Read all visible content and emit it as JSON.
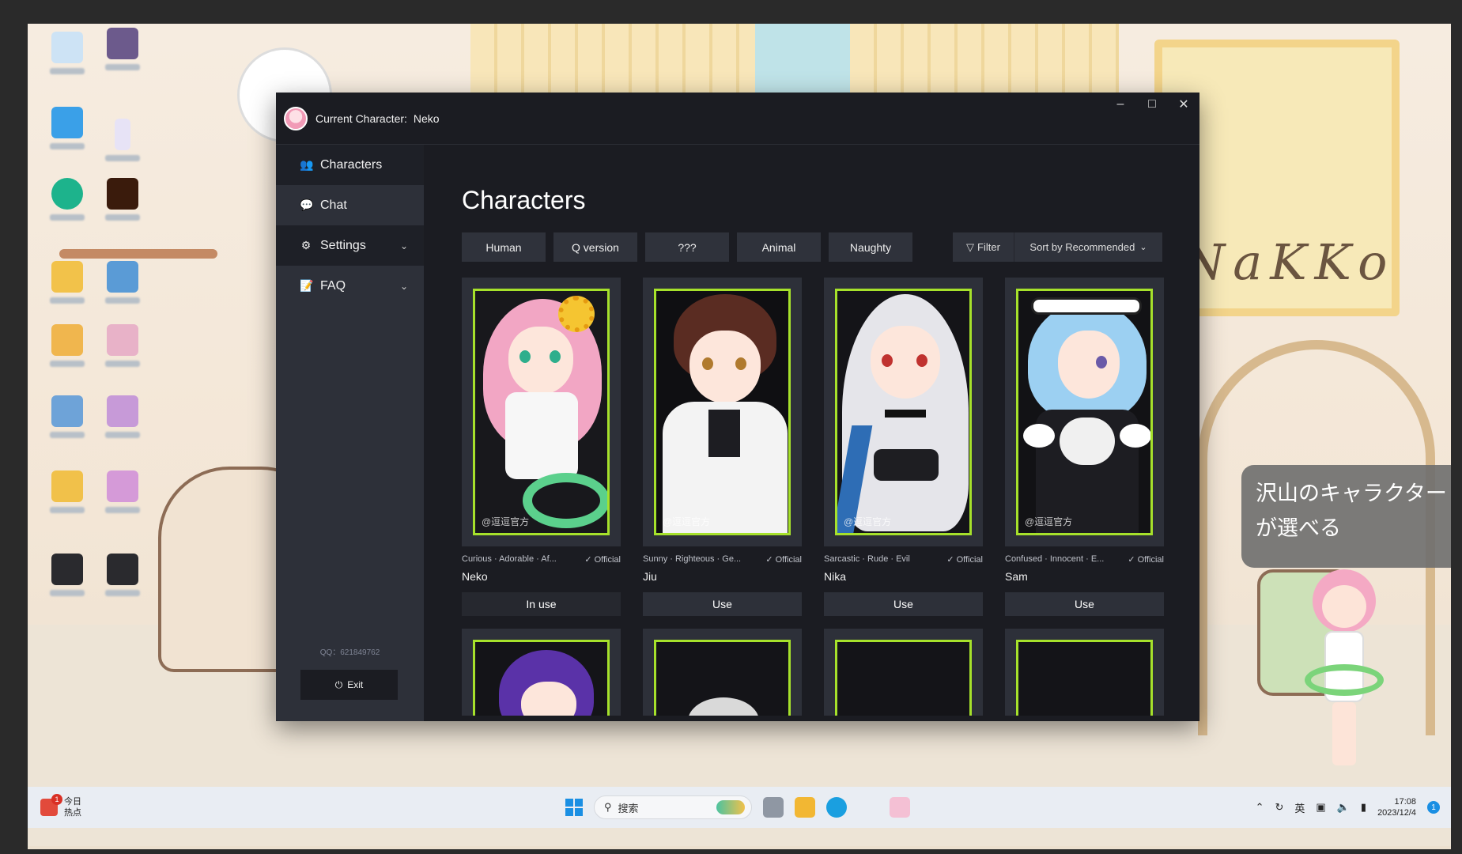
{
  "window": {
    "title_label": "Current Character:",
    "current_character": "Neko",
    "controls": {
      "minimize": "–",
      "maximize": "□",
      "close": "✕"
    }
  },
  "sidebar": {
    "items": [
      {
        "label": "Characters",
        "icon": "users-icon",
        "expandable": false
      },
      {
        "label": "Chat",
        "icon": "chat-icon",
        "expandable": false
      },
      {
        "label": "Settings",
        "icon": "gear-icon",
        "expandable": true
      },
      {
        "label": "FAQ",
        "icon": "document-edit-icon",
        "expandable": true
      }
    ],
    "qq": "QQ：621849762",
    "exit_label": "Exit"
  },
  "main": {
    "title": "Characters",
    "tabs": [
      "Human",
      "Q version",
      "???",
      "Animal",
      "Naughty"
    ],
    "filter_label": "Filter",
    "sort_label": "Sort by Recommended"
  },
  "cards": [
    {
      "tags": "Curious · Adorable · Af...",
      "official": "Official",
      "name": "Neko",
      "button": "In use",
      "watermark": "@逗逗官方",
      "hair_color": "#f2a6c4",
      "accent": "#f5c531"
    },
    {
      "tags": "Sunny · Righteous · Ge...",
      "official": "Official",
      "name": "Jiu",
      "button": "Use",
      "watermark": "@逗逗官方",
      "hair_color": "#5a2c22",
      "accent": "#ffffff"
    },
    {
      "tags": "Sarcastic · Rude · Evil",
      "official": "Official",
      "name": "Nika",
      "button": "Use",
      "watermark": "@逗逗官方",
      "hair_color": "#e5e5ea",
      "accent": "#1e1e22"
    },
    {
      "tags": "Confused · Innocent · E...",
      "official": "Official",
      "name": "Sam",
      "button": "Use",
      "watermark": "@逗逗官方",
      "hair_color": "#9cd0f2",
      "accent": "#111114"
    }
  ],
  "desktop_popup": "沢山のキャラクターが選べる",
  "desktop_sign": "NaKKo",
  "taskbar": {
    "news_label_1": "今日",
    "news_label_2": "热点",
    "news_badge": "1",
    "search_placeholder": "搜索",
    "ime": "英",
    "time": "17:08",
    "date": "2023/12/4",
    "notif": "1"
  },
  "colors": {
    "card_border": "#a6e12b",
    "sidebar_bg": "#2d3039",
    "app_bg": "#1b1c22"
  }
}
